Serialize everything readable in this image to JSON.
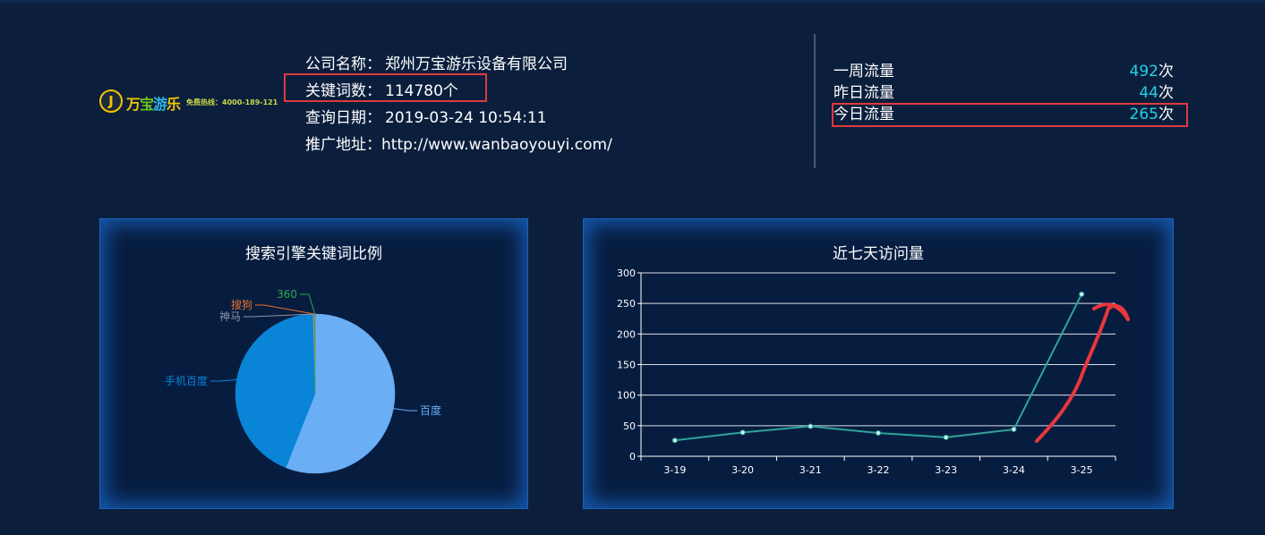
{
  "logo": {
    "glyph": "J",
    "brand_chars": [
      "万",
      "宝",
      "游",
      "乐"
    ],
    "hotline": "免费热线：4000-189-121"
  },
  "company": {
    "name_label": "公司名称：",
    "name_value": "郑州万宝游乐设备有限公司",
    "keywords_label": "关键词数：",
    "keywords_value": "114780个",
    "date_label": "查询日期：",
    "date_value": "2019-03-24 10:54:11",
    "url_label": "推广地址：",
    "url_value": "http://www.wanbaoyouyi.com/"
  },
  "traffic": [
    {
      "label": "一周流量",
      "value": "492",
      "unit": "次"
    },
    {
      "label": "昨日流量",
      "value": "44",
      "unit": "次"
    },
    {
      "label": "今日流量",
      "value": "265",
      "unit": "次"
    }
  ],
  "colors": {
    "accent": "#22d3e6",
    "highlight": "#e0393e",
    "line": "#2fa39b"
  },
  "chart_data": [
    {
      "type": "pie",
      "title": "搜索引擎关键词比例",
      "slices": [
        {
          "name": "百度",
          "value": 56,
          "color": "#6aaef5"
        },
        {
          "name": "手机百度",
          "value": 43.6,
          "color": "#0a84d6"
        },
        {
          "name": "神马",
          "value": 0.2,
          "color": "#8a96a8"
        },
        {
          "name": "搜狗",
          "value": 0.1,
          "color": "#e8702a"
        },
        {
          "name": "360",
          "value": 0.1,
          "color": "#2aa84a"
        }
      ]
    },
    {
      "type": "line",
      "title": "近七天访问量",
      "categories": [
        "3-19",
        "3-20",
        "3-21",
        "3-22",
        "3-23",
        "3-24",
        "3-25"
      ],
      "series": [
        {
          "values": [
            26,
            39,
            49,
            38,
            31,
            44,
            265
          ]
        }
      ],
      "ylim": [
        0,
        300
      ],
      "yticks": [
        0,
        50,
        100,
        150,
        200,
        250,
        300
      ],
      "grid": true
    }
  ]
}
